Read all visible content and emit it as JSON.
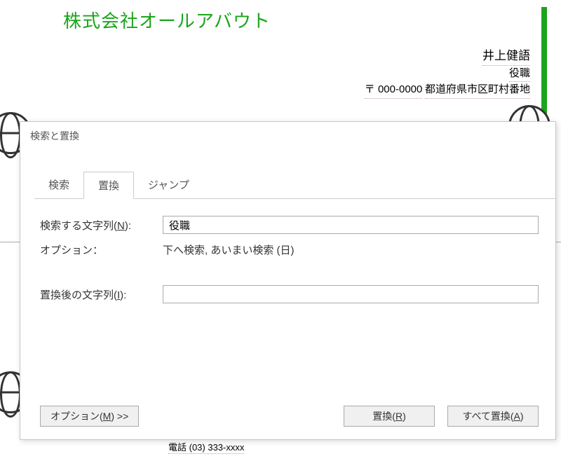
{
  "document": {
    "company": "株式会社オールアバウト",
    "name": "井上健語",
    "role": "役職",
    "address_prefix": "〒 000-0000",
    "address": "都道府県市区町村番地",
    "phone": "電話 (03) 333-xxxx"
  },
  "dialog": {
    "title": "検索と置換",
    "tabs": {
      "search": "検索",
      "replace": "置換",
      "jump": "ジャンプ"
    },
    "search_label_pre": "検索する文字列(",
    "search_label_accel": "N",
    "search_label_post": "):",
    "search_value": "役職",
    "options_label": "オプション：",
    "options_value": "下へ検索, あいまい検索 (日)",
    "replace_label_pre": "置換後の文字列(",
    "replace_label_accel": "I",
    "replace_label_post": "):",
    "replace_value": "",
    "buttons": {
      "options_pre": "オプション(",
      "options_accel": "M",
      "options_post": ") >>",
      "replace_pre": "置換(",
      "replace_accel": "R",
      "replace_post": ")",
      "replace_all_pre": "すべて置換(",
      "replace_all_accel": "A",
      "replace_all_post": ")"
    }
  }
}
